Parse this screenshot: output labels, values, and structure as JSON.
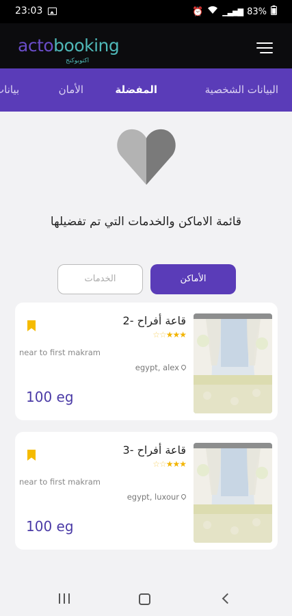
{
  "status_bar": {
    "time": "23:03",
    "battery": "83%",
    "icons": [
      "image-icon",
      "alarm-icon",
      "wifi-icon",
      "signal-icon",
      "battery-icon"
    ]
  },
  "app_bar": {
    "logo_part1": "acto",
    "logo_part2": "booking",
    "logo_sub": "اكتوبوكنج",
    "menu_icon": "hamburger-icon"
  },
  "tabs": [
    {
      "label": "البيانات الشخصية",
      "active": false
    },
    {
      "label": "المفضلة",
      "active": true
    },
    {
      "label": "الأمان",
      "active": false
    },
    {
      "label": "بيانات",
      "active": false
    }
  ],
  "favorites": {
    "heart_icon": "heart-icon",
    "heart_colors": [
      "#7a7a7a",
      "#b3b3b3"
    ],
    "title": "قائمة الاماكن والخدمات التي تم تفضيلها",
    "segment_places": "الأماكن",
    "segment_services": "الخدمات",
    "active_segment": "الأماكن"
  },
  "cards": [
    {
      "name": "قاعة أفراح -2",
      "rating": 3,
      "rating_max": 5,
      "description": "near to first makram",
      "location": "egypt, alex",
      "price": "100 eg",
      "bookmarked": true
    },
    {
      "name": "قاعة أفراح -3",
      "rating": 3,
      "rating_max": 5,
      "description": "near to first makram",
      "location": "egypt, luxour",
      "price": "100 eg",
      "bookmarked": true
    }
  ],
  "colors": {
    "accent": "#5a3cb8",
    "price": "#4a3aa6",
    "bookmark": "#f5bb00",
    "stars": "#f2b400"
  },
  "nav_bar": {
    "icons": [
      "recent-apps-icon",
      "home-icon",
      "back-icon"
    ]
  }
}
